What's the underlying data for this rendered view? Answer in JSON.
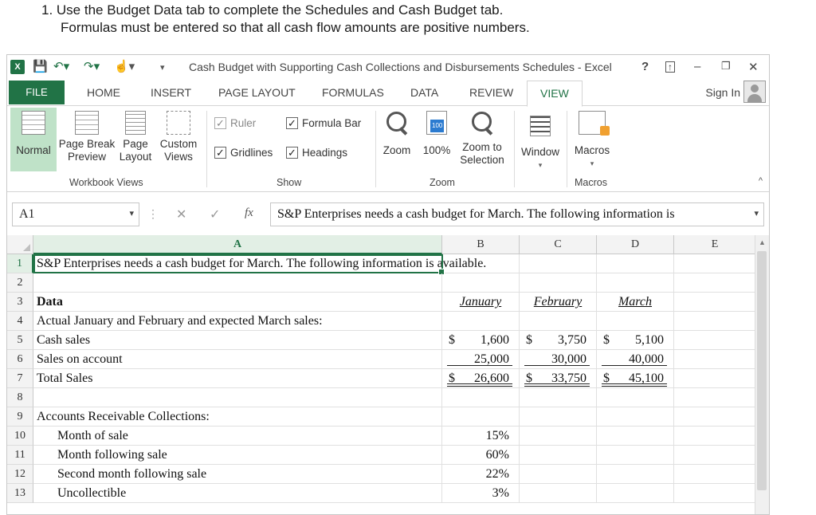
{
  "instructions": {
    "line1": "1. Use the Budget Data tab to complete the Schedules and Cash Budget tab.",
    "line2": "Formulas must be entered so that all cash flow amounts are positive numbers."
  },
  "titlebar": {
    "app_icon": "X",
    "title": "Cash Budget with Supporting Cash Collections and Disbursements Schedules - Excel",
    "help": "?",
    "icons": [
      "excel-logo-icon",
      "save-icon",
      "undo-icon",
      "redo-icon",
      "touch-mode-icon",
      "customize-qat-icon",
      "ribbon-options-icon",
      "minimize-icon",
      "restore-icon",
      "close-icon"
    ]
  },
  "tabs": {
    "file": "FILE",
    "items": [
      "HOME",
      "INSERT",
      "PAGE LAYOUT",
      "FORMULAS",
      "DATA",
      "REVIEW",
      "VIEW"
    ],
    "active": "VIEW",
    "sign_in": "Sign In"
  },
  "ribbon": {
    "workbook_views": {
      "label": "Workbook Views",
      "normal": "Normal",
      "page_break_1": "Page Break",
      "page_break_2": "Preview",
      "page_layout_1": "Page",
      "page_layout_2": "Layout",
      "custom_1": "Custom",
      "custom_2": "Views"
    },
    "show": {
      "label": "Show",
      "ruler": "Ruler",
      "formula_bar": "Formula Bar",
      "gridlines": "Gridlines",
      "headings": "Headings",
      "check": "✓"
    },
    "zoom": {
      "label": "Zoom",
      "zoom": "Zoom",
      "hundred": "100%",
      "zoom_sel_1": "Zoom to",
      "zoom_sel_2": "Selection"
    },
    "window": {
      "label": "Window",
      "arrow": "▾"
    },
    "macros": {
      "label": "Macros",
      "group_label": "Macros",
      "arrow": "▾"
    },
    "collapse": "^"
  },
  "formula_bar": {
    "name_box": "A1",
    "dropdown": "▾",
    "dots": "⋮",
    "cancel": "✕",
    "enter": "✓",
    "fx": "fx",
    "content": "S&P Enterprises needs a cash budget for March. The following information is"
  },
  "grid": {
    "columns": [
      "A",
      "B",
      "C",
      "D",
      "E"
    ],
    "rows": [
      {
        "n": "1",
        "a": "S&P Enterprises needs a cash budget for March. The following information is available."
      },
      {
        "n": "2",
        "a": ""
      },
      {
        "n": "3",
        "a": "Data",
        "b": "January",
        "c": "February",
        "d": "March"
      },
      {
        "n": "4",
        "a": "Actual January and February and expected March sales:"
      },
      {
        "n": "5",
        "a": "Cash sales",
        "b_cur": "$",
        "b": "1,600",
        "c_cur": "$",
        "c": "3,750",
        "d_cur": "$",
        "d": "5,100"
      },
      {
        "n": "6",
        "a": "Sales on account",
        "b": "25,000",
        "c": "30,000",
        "d": "40,000"
      },
      {
        "n": "7",
        "a": "Total Sales",
        "b_cur": "$",
        "b": "26,600",
        "c_cur": "$",
        "c": "33,750",
        "d_cur": "$",
        "d": "45,100"
      },
      {
        "n": "8",
        "a": ""
      },
      {
        "n": "9",
        "a": "Accounts Receivable Collections:"
      },
      {
        "n": "10",
        "a": "Month of sale",
        "b": "15%"
      },
      {
        "n": "11",
        "a": "Month following sale",
        "b": "60%"
      },
      {
        "n": "12",
        "a": "Second month following sale",
        "b": "22%"
      },
      {
        "n": "13",
        "a": "Uncollectible",
        "b": "3%"
      }
    ]
  }
}
